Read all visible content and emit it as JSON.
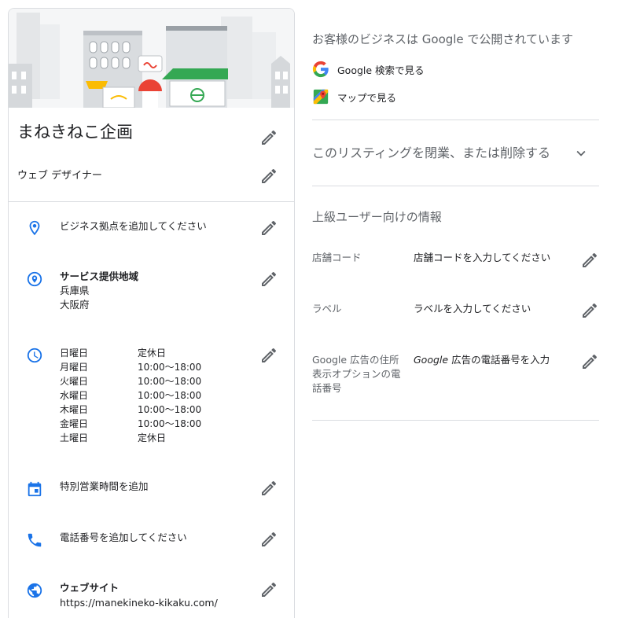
{
  "business": {
    "name": "まねきねこ企画",
    "category": "ウェブ デザイナー",
    "location_prompt": "ビジネス拠点を追加してください",
    "service_area": {
      "label": "サービス提供地域",
      "areas": [
        "兵庫県",
        "大阪府"
      ]
    },
    "hours": [
      {
        "day": "日曜日",
        "time": "定休日"
      },
      {
        "day": "月曜日",
        "time": "10:00～18:00"
      },
      {
        "day": "火曜日",
        "time": "10:00～18:00"
      },
      {
        "day": "水曜日",
        "time": "10:00～18:00"
      },
      {
        "day": "木曜日",
        "time": "10:00～18:00"
      },
      {
        "day": "金曜日",
        "time": "10:00～18:00"
      },
      {
        "day": "土曜日",
        "time": "定休日"
      }
    ],
    "special_hours_prompt": "特別営業時間を追加",
    "phone_prompt": "電話番号を追加してください",
    "website": {
      "label": "ウェブサイト",
      "url": "https://manekineko-kikaku.com/"
    }
  },
  "published": {
    "title": "お客様のビジネスは Google で公開されています",
    "search_link": "Google 検索で見る",
    "maps_link": "マップで見る"
  },
  "close_listing": {
    "label": "このリスティングを閉業、または削除する"
  },
  "advanced": {
    "title": "上級ユーザー向けの情報",
    "store_code": {
      "label": "店舗コード",
      "value": "店舗コードを入力してください"
    },
    "labels": {
      "label": "ラベル",
      "value": "ラベルを入力してください"
    },
    "ads_phone": {
      "label": "Google 広告の住所表示オプションの電話番号",
      "value_brand": "Google",
      "value_rest": " 広告の電話番号を入力"
    }
  },
  "icons": {
    "pencil": "pencil-icon",
    "location": "location-pin-icon",
    "service_area": "service-area-icon",
    "clock": "clock-icon",
    "calendar": "calendar-icon",
    "phone": "phone-icon",
    "globe": "globe-icon",
    "google": "google-g-icon",
    "maps": "google-maps-icon",
    "chevron": "chevron-down-icon"
  },
  "colors": {
    "accent": "#1a73e8",
    "text": "#202124",
    "muted": "#5f6368",
    "divider": "#dadce0"
  }
}
